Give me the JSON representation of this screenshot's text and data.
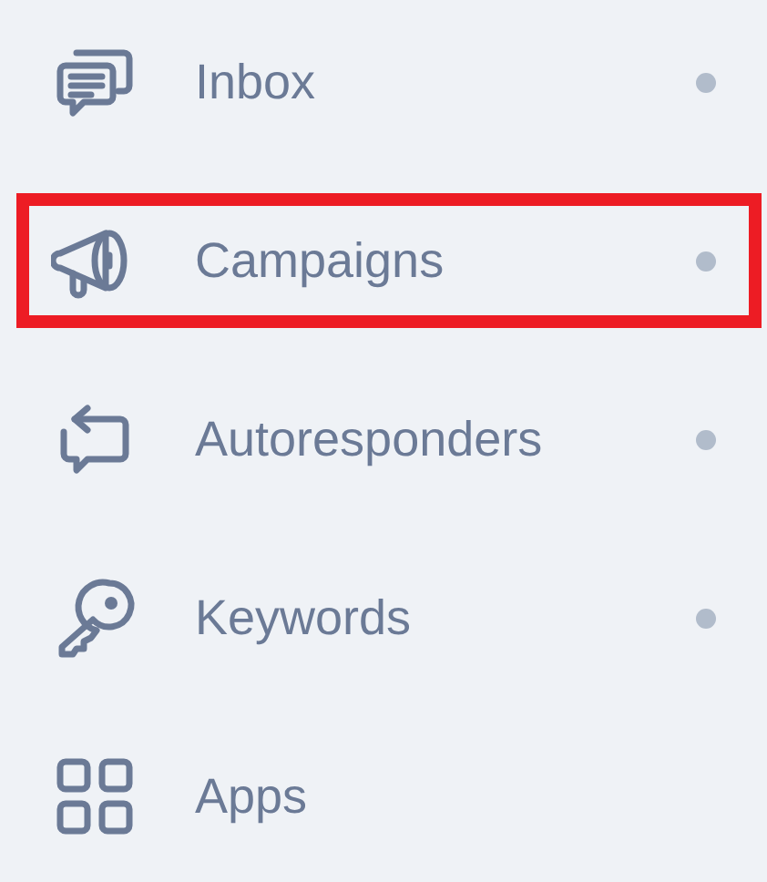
{
  "nav_items": [
    {
      "kind": "inbox",
      "label": "Inbox",
      "dot": true,
      "highlighted": false
    },
    {
      "kind": "campaigns",
      "label": "Campaigns",
      "dot": true,
      "highlighted": true
    },
    {
      "kind": "autoresponders",
      "label": "Autoresponders",
      "dot": true,
      "highlighted": false
    },
    {
      "kind": "keywords",
      "label": "Keywords",
      "dot": true,
      "highlighted": false
    },
    {
      "kind": "apps",
      "label": "Apps",
      "dot": false,
      "highlighted": false
    }
  ]
}
